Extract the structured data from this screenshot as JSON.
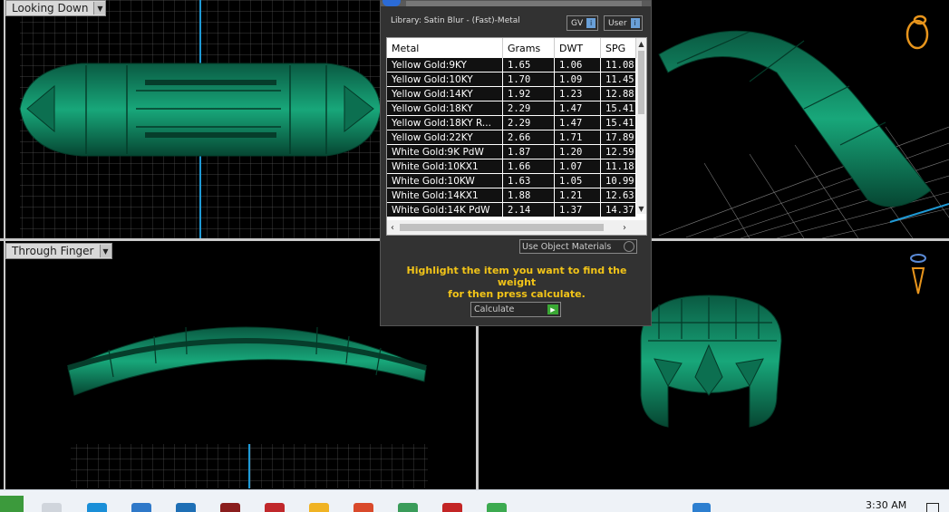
{
  "viewports": {
    "top_left_label": "Looking Down",
    "bottom_left_label": "Through Finger"
  },
  "dialog": {
    "library": "Library: Satin Blur - (Fast)-Metal",
    "gv_label": "GV",
    "user_label": "User",
    "columns": [
      "Metal",
      "Grams",
      "DWT",
      "SPG"
    ],
    "rows": [
      [
        "Yellow Gold:9KY",
        "1.65",
        "1.06",
        "11.08"
      ],
      [
        "Yellow Gold:10KY",
        "1.70",
        "1.09",
        "11.45"
      ],
      [
        "Yellow Gold:14KY",
        "1.92",
        "1.23",
        "12.88"
      ],
      [
        "Yellow Gold:18KY",
        "2.29",
        "1.47",
        "15.41"
      ],
      [
        "Yellow Gold:18KY R...",
        "2.29",
        "1.47",
        "15.41"
      ],
      [
        "Yellow Gold:22KY",
        "2.66",
        "1.71",
        "17.89"
      ],
      [
        "White Gold:9K PdW",
        "1.87",
        "1.20",
        "12.59"
      ],
      [
        "White Gold:10KX1",
        "1.66",
        "1.07",
        "11.18"
      ],
      [
        "White Gold:10KW",
        "1.63",
        "1.05",
        "10.99"
      ],
      [
        "White Gold:14KX1",
        "1.88",
        "1.21",
        "12.63"
      ],
      [
        "White Gold:14K PdW",
        "2.14",
        "1.37",
        "14.37"
      ]
    ],
    "use_object_materials": "Use Object Materials",
    "instruction_line1": "Highlight the item you want to find the weight",
    "instruction_line2": "for then press calculate.",
    "calculate_label": "Calculate"
  },
  "taskbar": {
    "clock": "3:30 AM"
  },
  "colors": {
    "ring_green": "#0f7a5a",
    "highlight_text": "#f2c418",
    "accent_blue": "#1f9ad6"
  }
}
